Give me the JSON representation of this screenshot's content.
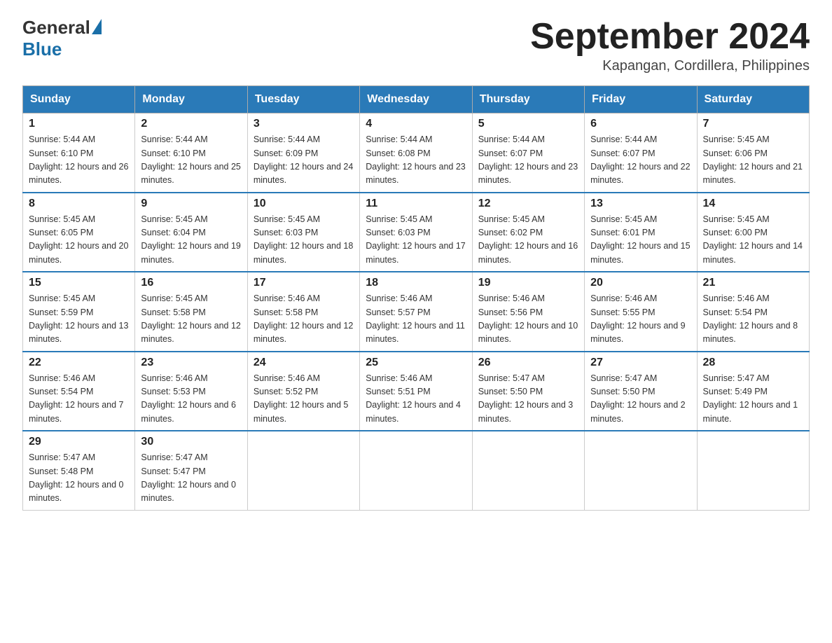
{
  "header": {
    "logo_general": "General",
    "logo_blue": "Blue",
    "title": "September 2024",
    "subtitle": "Kapangan, Cordillera, Philippines"
  },
  "days_of_week": [
    "Sunday",
    "Monday",
    "Tuesday",
    "Wednesday",
    "Thursday",
    "Friday",
    "Saturday"
  ],
  "weeks": [
    [
      {
        "day": "1",
        "sunrise": "5:44 AM",
        "sunset": "6:10 PM",
        "daylight": "12 hours and 26 minutes."
      },
      {
        "day": "2",
        "sunrise": "5:44 AM",
        "sunset": "6:10 PM",
        "daylight": "12 hours and 25 minutes."
      },
      {
        "day": "3",
        "sunrise": "5:44 AM",
        "sunset": "6:09 PM",
        "daylight": "12 hours and 24 minutes."
      },
      {
        "day": "4",
        "sunrise": "5:44 AM",
        "sunset": "6:08 PM",
        "daylight": "12 hours and 23 minutes."
      },
      {
        "day": "5",
        "sunrise": "5:44 AM",
        "sunset": "6:07 PM",
        "daylight": "12 hours and 23 minutes."
      },
      {
        "day": "6",
        "sunrise": "5:44 AM",
        "sunset": "6:07 PM",
        "daylight": "12 hours and 22 minutes."
      },
      {
        "day": "7",
        "sunrise": "5:45 AM",
        "sunset": "6:06 PM",
        "daylight": "12 hours and 21 minutes."
      }
    ],
    [
      {
        "day": "8",
        "sunrise": "5:45 AM",
        "sunset": "6:05 PM",
        "daylight": "12 hours and 20 minutes."
      },
      {
        "day": "9",
        "sunrise": "5:45 AM",
        "sunset": "6:04 PM",
        "daylight": "12 hours and 19 minutes."
      },
      {
        "day": "10",
        "sunrise": "5:45 AM",
        "sunset": "6:03 PM",
        "daylight": "12 hours and 18 minutes."
      },
      {
        "day": "11",
        "sunrise": "5:45 AM",
        "sunset": "6:03 PM",
        "daylight": "12 hours and 17 minutes."
      },
      {
        "day": "12",
        "sunrise": "5:45 AM",
        "sunset": "6:02 PM",
        "daylight": "12 hours and 16 minutes."
      },
      {
        "day": "13",
        "sunrise": "5:45 AM",
        "sunset": "6:01 PM",
        "daylight": "12 hours and 15 minutes."
      },
      {
        "day": "14",
        "sunrise": "5:45 AM",
        "sunset": "6:00 PM",
        "daylight": "12 hours and 14 minutes."
      }
    ],
    [
      {
        "day": "15",
        "sunrise": "5:45 AM",
        "sunset": "5:59 PM",
        "daylight": "12 hours and 13 minutes."
      },
      {
        "day": "16",
        "sunrise": "5:45 AM",
        "sunset": "5:58 PM",
        "daylight": "12 hours and 12 minutes."
      },
      {
        "day": "17",
        "sunrise": "5:46 AM",
        "sunset": "5:58 PM",
        "daylight": "12 hours and 12 minutes."
      },
      {
        "day": "18",
        "sunrise": "5:46 AM",
        "sunset": "5:57 PM",
        "daylight": "12 hours and 11 minutes."
      },
      {
        "day": "19",
        "sunrise": "5:46 AM",
        "sunset": "5:56 PM",
        "daylight": "12 hours and 10 minutes."
      },
      {
        "day": "20",
        "sunrise": "5:46 AM",
        "sunset": "5:55 PM",
        "daylight": "12 hours and 9 minutes."
      },
      {
        "day": "21",
        "sunrise": "5:46 AM",
        "sunset": "5:54 PM",
        "daylight": "12 hours and 8 minutes."
      }
    ],
    [
      {
        "day": "22",
        "sunrise": "5:46 AM",
        "sunset": "5:54 PM",
        "daylight": "12 hours and 7 minutes."
      },
      {
        "day": "23",
        "sunrise": "5:46 AM",
        "sunset": "5:53 PM",
        "daylight": "12 hours and 6 minutes."
      },
      {
        "day": "24",
        "sunrise": "5:46 AM",
        "sunset": "5:52 PM",
        "daylight": "12 hours and 5 minutes."
      },
      {
        "day": "25",
        "sunrise": "5:46 AM",
        "sunset": "5:51 PM",
        "daylight": "12 hours and 4 minutes."
      },
      {
        "day": "26",
        "sunrise": "5:47 AM",
        "sunset": "5:50 PM",
        "daylight": "12 hours and 3 minutes."
      },
      {
        "day": "27",
        "sunrise": "5:47 AM",
        "sunset": "5:50 PM",
        "daylight": "12 hours and 2 minutes."
      },
      {
        "day": "28",
        "sunrise": "5:47 AM",
        "sunset": "5:49 PM",
        "daylight": "12 hours and 1 minute."
      }
    ],
    [
      {
        "day": "29",
        "sunrise": "5:47 AM",
        "sunset": "5:48 PM",
        "daylight": "12 hours and 0 minutes."
      },
      {
        "day": "30",
        "sunrise": "5:47 AM",
        "sunset": "5:47 PM",
        "daylight": "12 hours and 0 minutes."
      },
      null,
      null,
      null,
      null,
      null
    ]
  ]
}
